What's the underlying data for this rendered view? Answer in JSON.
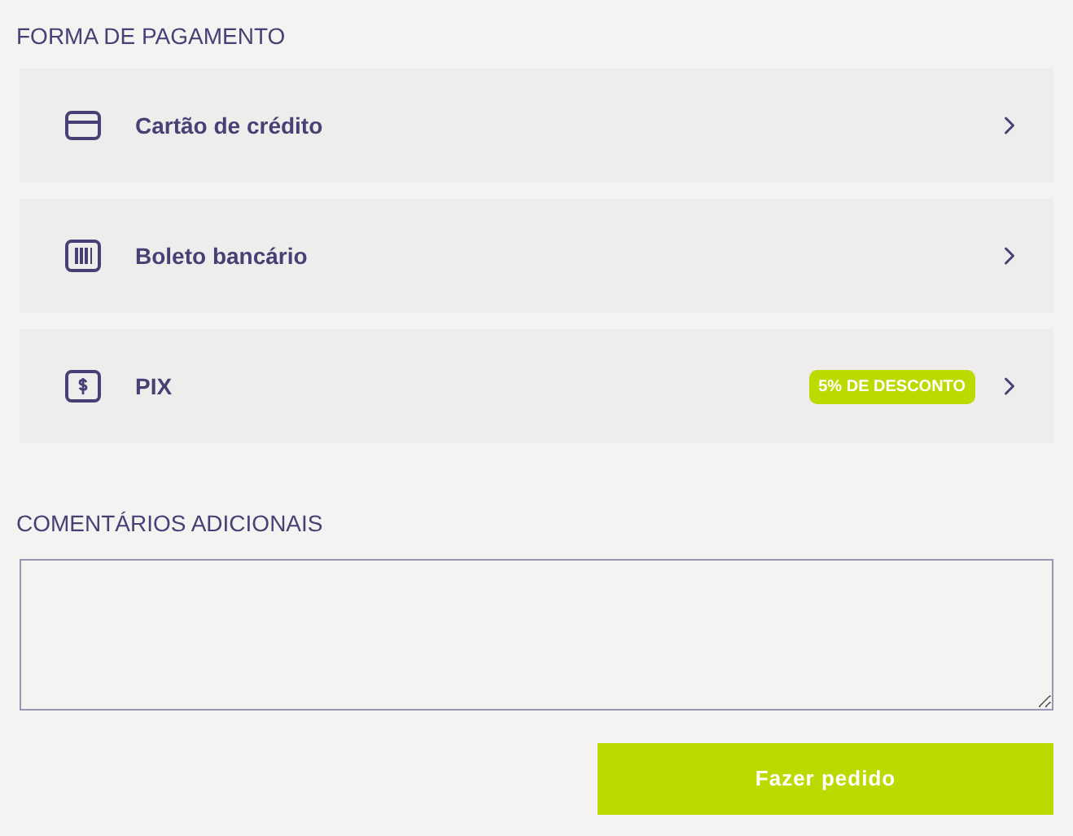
{
  "payment": {
    "title": "FORMA DE PAGAMENTO",
    "methods": [
      {
        "kind": "card",
        "label": "Cartão de crédito"
      },
      {
        "kind": "barcode",
        "label": "Boleto bancário"
      },
      {
        "kind": "pix",
        "label": "PIX",
        "badge": "5% DE DESCONTO"
      }
    ]
  },
  "comments": {
    "title": "COMENTÁRIOS ADICIONAIS"
  },
  "submit": {
    "label": "Fazer pedido"
  }
}
